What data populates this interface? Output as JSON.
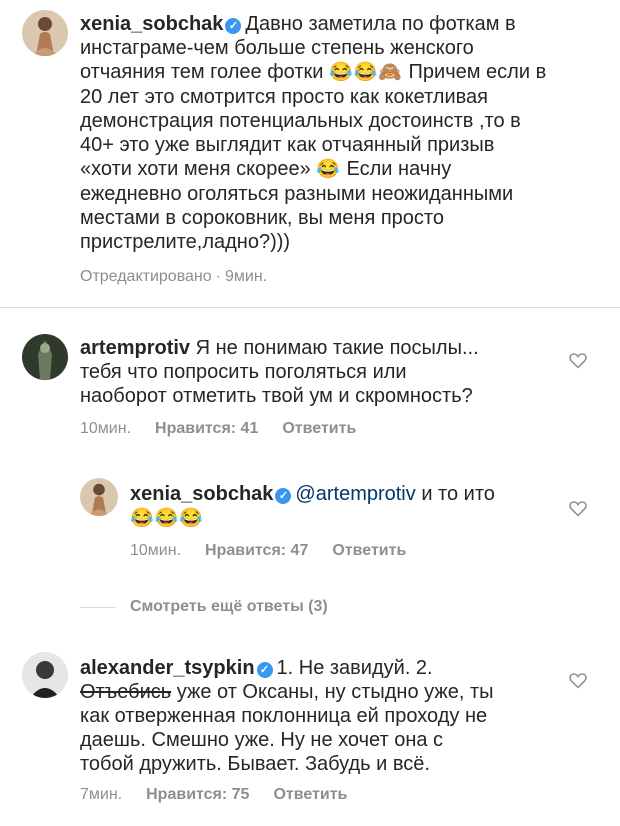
{
  "caption": {
    "username": "xenia_sobchak",
    "text_line1": "Давно заметила по фоткам в",
    "text_line2": "инстаграме-чем больше степень женского",
    "text_line3a": "отчаяния тем голее фотки",
    "text_line3_emoji": "😂😂🙈",
    "text_line3b": "Причем если в",
    "text_line4": "20 лет это смотрится просто как кокетливая",
    "text_line5": "демонстрация потенциальных достоинств ,то в",
    "text_line6": "40+ это уже выглядит как отчаянный призыв",
    "text_line7a": "«хоти хоти меня скорее»",
    "text_line7_emoji": "😂",
    "text_line7b": "Если начну",
    "text_line8": "ежедневно оголяться разными неожиданными",
    "text_line9": "местами в сороковник, вы меня просто",
    "text_line10": "пристрелите,ладно?)))",
    "edited": "Отредактировано",
    "time": "9мин."
  },
  "comment1": {
    "username": "artemprotiv",
    "text_line1": "Я не понимаю такие посылы...",
    "text_line2": "тебя что попросить поголяться или",
    "text_line3": "наоборот отметить твой ум и скромность?",
    "time": "10мин.",
    "likes": "Нравится: 41",
    "reply": "Ответить"
  },
  "reply1": {
    "username": "xenia_sobchak",
    "mention": "@artemprotiv",
    "text": "и то ито",
    "emoji": "😂😂😂",
    "time": "10мин.",
    "likes": "Нравится: 47",
    "reply": "Ответить"
  },
  "view_more": "Смотреть ещё ответы (3)",
  "comment2": {
    "username": "alexander_tsypkin",
    "text_line1": "1. Не завидуй. 2.",
    "text_line2_strike": "Отъебись",
    "text_line2": "уже от Оксаны, ну стыдно уже, ты",
    "text_line3": "как отверженная поклонница ей проходу не",
    "text_line4": "даешь. Смешно уже. Ну не хочет она с",
    "text_line5": "тобой дружить. Бывает. Забудь и всё.",
    "time": "7мин.",
    "likes": "Нравится: 75",
    "reply": "Ответить"
  },
  "colors": {
    "text": "#262626",
    "meta": "#8e8e8e",
    "verified": "#3897f0",
    "mention": "#00376b",
    "divider": "#dbdbdb"
  }
}
